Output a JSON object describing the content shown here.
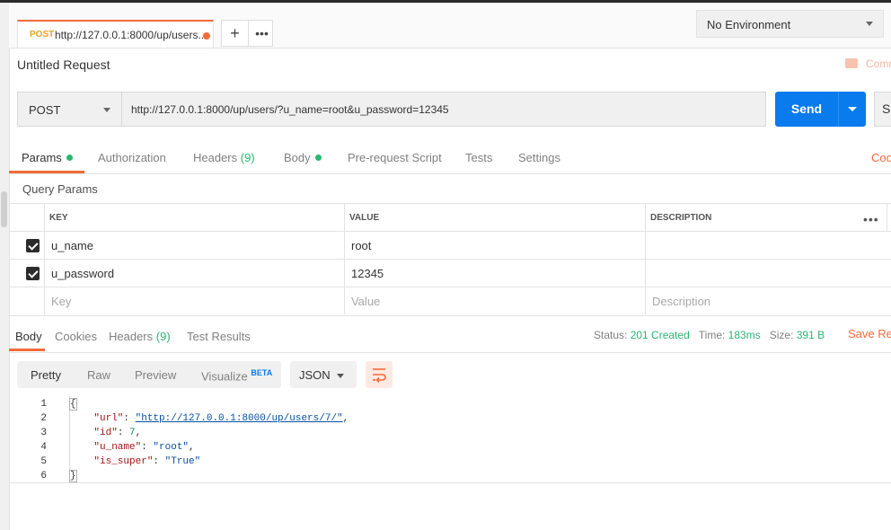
{
  "tab": {
    "method": "POST",
    "url": "http://127.0.0.1:8000/up/users..."
  },
  "env": {
    "selected": "No Environment"
  },
  "request": {
    "title": "Untitled Request",
    "comments_label": "Comm",
    "method": "POST",
    "url": "http://127.0.0.1:8000/up/users/?u_name=root&u_password=12345",
    "send_label": "Send",
    "save_label": "Sa"
  },
  "req_tabs": {
    "params": "Params",
    "authorization": "Authorization",
    "headers": "Headers",
    "headers_count": "(9)",
    "body": "Body",
    "prerequest": "Pre-request Script",
    "tests": "Tests",
    "settings": "Settings",
    "cookies": "Coo"
  },
  "query_params": {
    "title": "Query Params",
    "columns": {
      "key": "KEY",
      "value": "VALUE",
      "description": "DESCRIPTION"
    },
    "rows": [
      {
        "key": "u_name",
        "value": "root",
        "description": ""
      },
      {
        "key": "u_password",
        "value": "12345",
        "description": ""
      }
    ],
    "placeholder": {
      "key": "Key",
      "value": "Value",
      "description": "Description"
    }
  },
  "resp_tabs": {
    "body": "Body",
    "cookies": "Cookies",
    "headers": "Headers",
    "headers_count": "(9)",
    "test_results": "Test Results"
  },
  "status": {
    "status_label": "Status:",
    "status_value": "201 Created",
    "time_label": "Time:",
    "time_value": "183ms",
    "size_label": "Size:",
    "size_value": "391 B",
    "save_response": "Save Res"
  },
  "view": {
    "pretty": "Pretty",
    "raw": "Raw",
    "preview": "Preview",
    "visualize": "Visualize",
    "beta": "BETA",
    "format": "JSON"
  },
  "code_lines": {
    "n1": "1",
    "n2": "2",
    "n3": "3",
    "n4": "4",
    "n5": "5",
    "n6": "6",
    "open": "{",
    "close": "}",
    "k_url": "\"url\"",
    "v_url": "\"http://127.0.0.1:8000/up/users/7/\"",
    "k_id": "\"id\"",
    "v_id": "7",
    "k_uname": "\"u_name\"",
    "v_uname": "\"root\"",
    "k_super": "\"is_super\"",
    "v_super": "\"True\""
  },
  "icons": {
    "add": "plus-icon",
    "more": "ellipsis-icon",
    "wrap": "wrap-lines-icon",
    "comment": "comment-icon"
  },
  "colors": {
    "accent": "#f26b3a",
    "send": "#097bed",
    "success": "#2ab673"
  }
}
